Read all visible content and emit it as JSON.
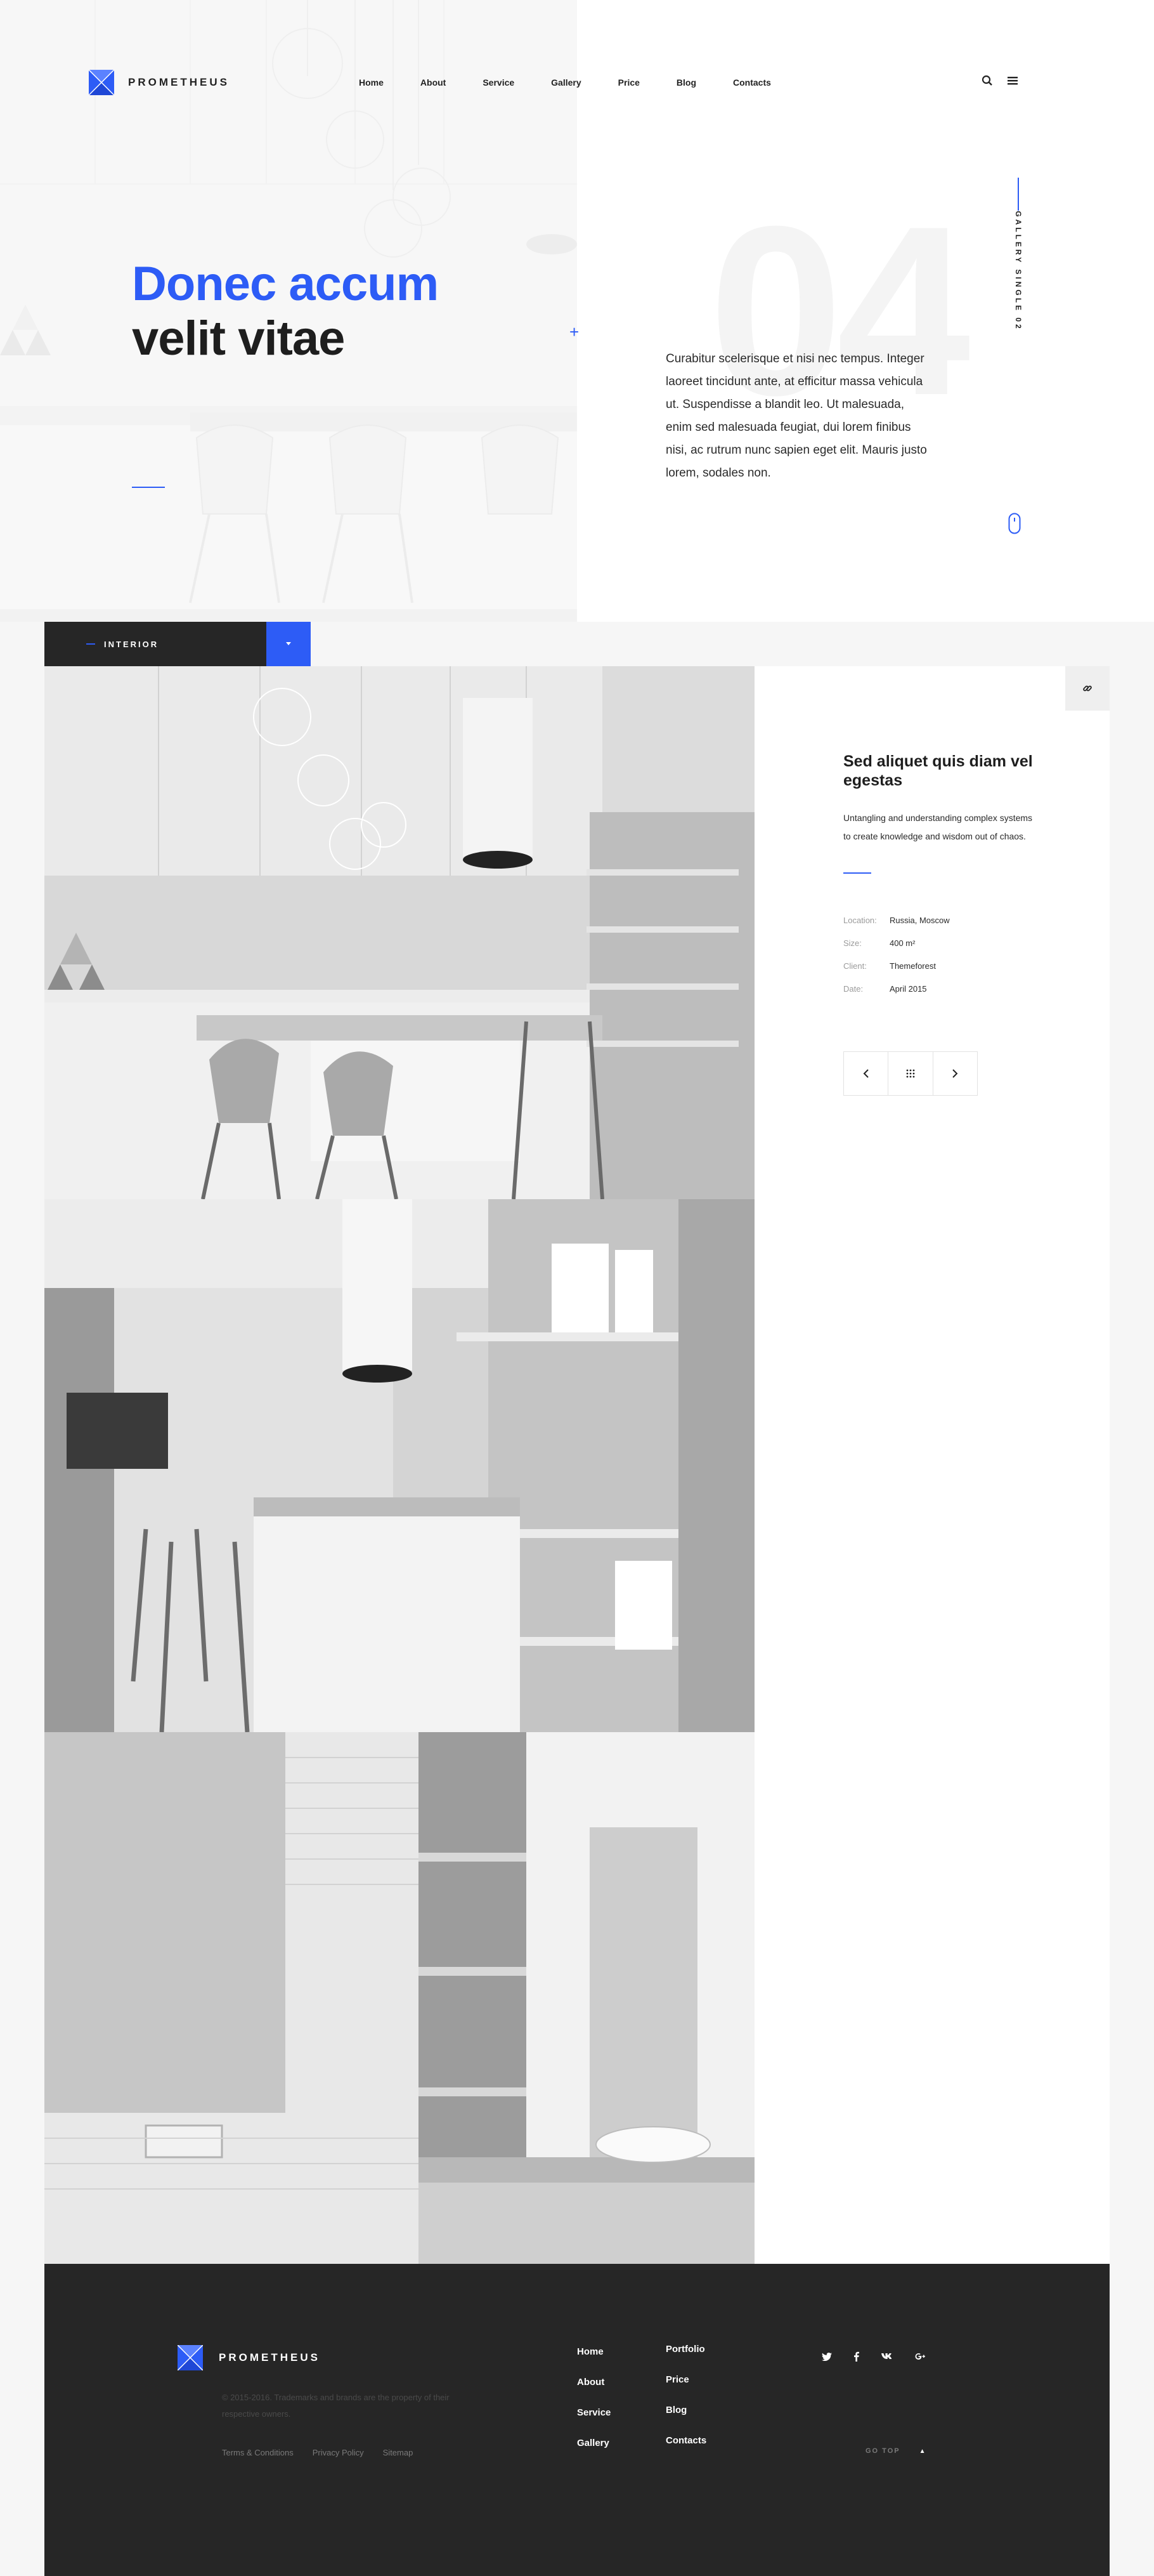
{
  "brand": {
    "name": "PROMETHEUS",
    "accent": "#2d5cf6",
    "dark": "#262626"
  },
  "nav": {
    "items": [
      "Home",
      "About",
      "Service",
      "Gallery",
      "Price",
      "Blog",
      "Contacts"
    ],
    "search_icon": "search-icon",
    "menu_icon": "hamburger-menu-icon"
  },
  "hero": {
    "title_line1": "Donec accum",
    "title_line2": "velit vitae",
    "plus": "+",
    "big_number": "04",
    "description": "Curabitur scelerisque et nisi nec tempus. Integer laoreet tincidunt ante, at efficitur massa vehicula ut. Suspendisse a blandit leo. Ut malesuada, enim sed malesuada feugiat, dui lorem finibus nisi, ac rutrum nunc sapien eget elit. Mauris justo lorem, sodales non.",
    "side_label": "GALLERY SINGLE 02"
  },
  "category": {
    "label": "INTERIOR"
  },
  "project": {
    "title": "Sed aliquet quis diam vel egestas",
    "text": "Untangling and understanding complex systems to create knowledge and wisdom out of chaos.",
    "meta": [
      {
        "key": "Location:",
        "value": "Russia, Moscow"
      },
      {
        "key": "Size:",
        "value": "400 m²"
      },
      {
        "key": "Client:",
        "value": "Themeforest"
      },
      {
        "key": "Date:",
        "value": "April 2015"
      }
    ]
  },
  "footer": {
    "brand": "PROMETHEUS",
    "copyright": "© 2015-2016. Trademarks and brands are the property of their respective owners.",
    "legal_links": [
      "Terms & Conditions",
      "Privacy Policy",
      "Sitemap"
    ],
    "col1": [
      "Home",
      "About",
      "Service",
      "Gallery"
    ],
    "col2": [
      "Portfolio",
      "Price",
      "Blog",
      "Contacts"
    ],
    "social": [
      "twitter-icon",
      "facebook-icon",
      "vk-icon",
      "google-plus-icon"
    ],
    "go_top": "GO TOP",
    "go_top_arrow": "▲"
  }
}
